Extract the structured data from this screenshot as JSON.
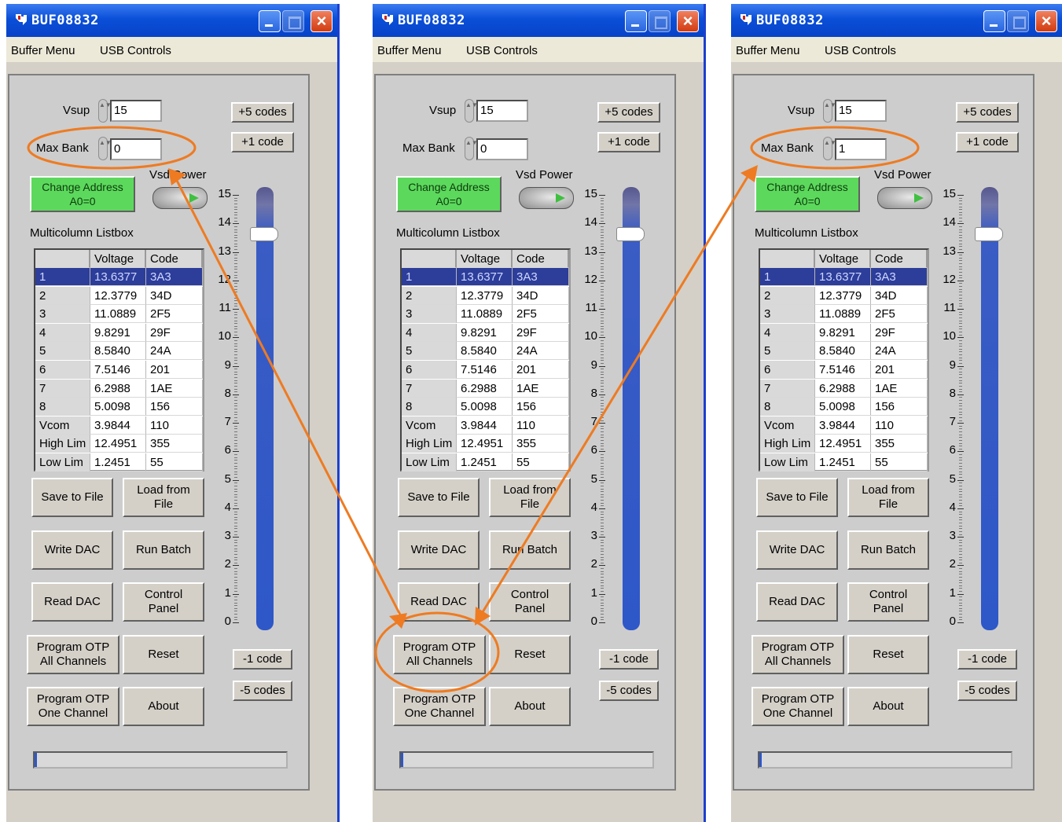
{
  "colors": {
    "highlight": "#ee7b22",
    "title_bar": "#0a4fd8",
    "slider": "#2e57c8",
    "green_button": "#5cd95c"
  },
  "windows": [
    {
      "title": "BUF08832",
      "menu": [
        "Buffer Menu",
        "USB Controls"
      ],
      "vsup_label": "Vsup",
      "vsup_value": "15",
      "maxbank_label": "Max Bank",
      "maxbank_value": "0",
      "plus5": "+5 codes",
      "plus1": "+1 code",
      "minus1": "-1 code",
      "minus5": "-5 codes",
      "change_address": "Change Address\nA0=0",
      "vsd_power": "Vsd Power",
      "listbox_label": "Multicolumn Listbox",
      "columns": [
        "",
        "Voltage",
        "Code"
      ],
      "rows": [
        [
          "1",
          "13.6377",
          "3A3"
        ],
        [
          "2",
          "12.3779",
          "34D"
        ],
        [
          "3",
          "11.0889",
          "2F5"
        ],
        [
          "4",
          "9.8291",
          "29F"
        ],
        [
          "5",
          "8.5840",
          "24A"
        ],
        [
          "6",
          "7.5146",
          "201"
        ],
        [
          "7",
          "6.2988",
          "1AE"
        ],
        [
          "8",
          "5.0098",
          "156"
        ],
        [
          "Vcom",
          "3.9844",
          "110"
        ],
        [
          "High Lim",
          "12.4951",
          "355"
        ],
        [
          "Low Lim",
          "1.2451",
          "55"
        ]
      ],
      "buttons": [
        "Save to File",
        "Load from\nFile",
        "Write DAC",
        "Run Batch",
        "Read DAC",
        "Control\nPanel",
        "Program OTP\nAll Channels",
        "Reset",
        "Program OTP\nOne Channel",
        "About"
      ],
      "scale": [
        "15",
        "14",
        "13",
        "12",
        "11",
        "10",
        "9",
        "8",
        "7",
        "6",
        "5",
        "4",
        "3",
        "2",
        "1",
        "0"
      ],
      "slider_value": 13.6377,
      "progress": 0.01
    },
    {
      "title": "BUF08832",
      "menu": [
        "Buffer Menu",
        "USB Controls"
      ],
      "vsup_label": "Vsup",
      "vsup_value": "15",
      "maxbank_label": "Max Bank",
      "maxbank_value": "0",
      "plus5": "+5 codes",
      "plus1": "+1 code",
      "minus1": "-1 code",
      "minus5": "-5 codes",
      "change_address": "Change Address\nA0=0",
      "vsd_power": "Vsd Power",
      "listbox_label": "Multicolumn Listbox",
      "columns": [
        "",
        "Voltage",
        "Code"
      ],
      "rows": [
        [
          "1",
          "13.6377",
          "3A3"
        ],
        [
          "2",
          "12.3779",
          "34D"
        ],
        [
          "3",
          "11.0889",
          "2F5"
        ],
        [
          "4",
          "9.8291",
          "29F"
        ],
        [
          "5",
          "8.5840",
          "24A"
        ],
        [
          "6",
          "7.5146",
          "201"
        ],
        [
          "7",
          "6.2988",
          "1AE"
        ],
        [
          "8",
          "5.0098",
          "156"
        ],
        [
          "Vcom",
          "3.9844",
          "110"
        ],
        [
          "High Lim",
          "12.4951",
          "355"
        ],
        [
          "Low Lim",
          "1.2451",
          "55"
        ]
      ],
      "buttons": [
        "Save to File",
        "Load from\nFile",
        "Write DAC",
        "Run Batch",
        "Read DAC",
        "Control\nPanel",
        "Program OTP\nAll Channels",
        "Reset",
        "Program OTP\nOne Channel",
        "About"
      ],
      "scale": [
        "15",
        "14",
        "13",
        "12",
        "11",
        "10",
        "9",
        "8",
        "7",
        "6",
        "5",
        "4",
        "3",
        "2",
        "1",
        "0"
      ],
      "slider_value": 13.6377,
      "progress": 0.01
    },
    {
      "title": "BUF08832",
      "menu": [
        "Buffer Menu",
        "USB Controls"
      ],
      "vsup_label": "Vsup",
      "vsup_value": "15",
      "maxbank_label": "Max Bank",
      "maxbank_value": "1",
      "plus5": "+5 codes",
      "plus1": "+1 code",
      "minus1": "-1 code",
      "minus5": "-5 codes",
      "change_address": "Change Address\nA0=0",
      "vsd_power": "Vsd Power",
      "listbox_label": "Multicolumn Listbox",
      "columns": [
        "",
        "Voltage",
        "Code"
      ],
      "rows": [
        [
          "1",
          "13.6377",
          "3A3"
        ],
        [
          "2",
          "12.3779",
          "34D"
        ],
        [
          "3",
          "11.0889",
          "2F5"
        ],
        [
          "4",
          "9.8291",
          "29F"
        ],
        [
          "5",
          "8.5840",
          "24A"
        ],
        [
          "6",
          "7.5146",
          "201"
        ],
        [
          "7",
          "6.2988",
          "1AE"
        ],
        [
          "8",
          "5.0098",
          "156"
        ],
        [
          "Vcom",
          "3.9844",
          "110"
        ],
        [
          "High Lim",
          "12.4951",
          "355"
        ],
        [
          "Low Lim",
          "1.2451",
          "55"
        ]
      ],
      "buttons": [
        "Save to File",
        "Load from\nFile",
        "Write DAC",
        "Run Batch",
        "Read DAC",
        "Control\nPanel",
        "Program OTP\nAll Channels",
        "Reset",
        "Program OTP\nOne Channel",
        "About"
      ],
      "scale": [
        "15",
        "14",
        "13",
        "12",
        "11",
        "10",
        "9",
        "8",
        "7",
        "6",
        "5",
        "4",
        "3",
        "2",
        "1",
        "0"
      ],
      "slider_value": 13.6377,
      "progress": 0.01
    }
  ]
}
